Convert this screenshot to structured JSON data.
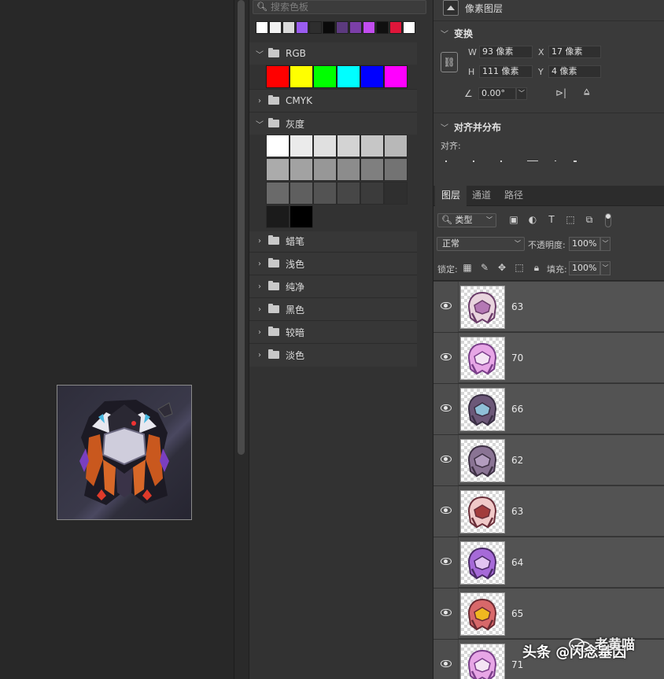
{
  "swatches": {
    "search_placeholder": "搜索色板",
    "recent_colors": [
      "#ffffff",
      "#f2f2f2",
      "#d9d9d9",
      "#9a5cf0",
      "#2e2e2e",
      "#0a0a0a",
      "#5c3a7e",
      "#7b3fa8",
      "#c24df0",
      "#101010",
      "#e0163a",
      "#ffffff"
    ],
    "groups": [
      {
        "label": "RGB",
        "expanded": true,
        "colors": [
          "#ff0000",
          "#ffff00",
          "#00ff00",
          "#00ffff",
          "#0000ff",
          "#ff00ff"
        ]
      },
      {
        "label": "CMYK",
        "expanded": false
      },
      {
        "label": "灰度",
        "expanded": true,
        "colors": [
          "#ffffff",
          "#ebebeb",
          "#e0e0e0",
          "#d3d3d3",
          "#c6c6c6",
          "#b8b8b8",
          "#ababab",
          "#a2a2a2",
          "#979797",
          "#8c8c8c",
          "#7f7f7f",
          "#737373",
          "#6a6a6a",
          "#5f5f5f",
          "#535353",
          "#474747",
          "#3b3b3b",
          "#2f2f2f",
          "#1b1b1b",
          "#000000"
        ]
      },
      {
        "label": "蜡笔",
        "expanded": false
      },
      {
        "label": "浅色",
        "expanded": false
      },
      {
        "label": "纯净",
        "expanded": false
      },
      {
        "label": "黑色",
        "expanded": false
      },
      {
        "label": "较暗",
        "expanded": false
      },
      {
        "label": "淡色",
        "expanded": false
      }
    ]
  },
  "properties": {
    "layer_type": "像素图层",
    "transform_title": "变换",
    "w_label": "W",
    "w_value": "93 像素",
    "x_label": "X",
    "x_value": "17 像素",
    "h_label": "H",
    "h_value": "111 像素",
    "y_label": "Y",
    "y_value": "4 像素",
    "angle_value": "0.00°",
    "align_title": "对齐并分布",
    "align_label": "对齐:"
  },
  "layers_panel": {
    "tabs": [
      "图层",
      "通道",
      "路径"
    ],
    "active_tab": "图层",
    "kind_filter": "类型",
    "blend_mode": "正常",
    "opacity_label": "不透明度:",
    "opacity_value": "100%",
    "lock_label": "锁定:",
    "fill_label": "填充:",
    "fill_value": "100%",
    "layers": [
      {
        "name": "63",
        "variant": "pale"
      },
      {
        "name": "70",
        "variant": "pink"
      },
      {
        "name": "66",
        "variant": "dark"
      },
      {
        "name": "62",
        "variant": "shell"
      },
      {
        "name": "63",
        "variant": "ring"
      },
      {
        "name": "64",
        "variant": "violet"
      },
      {
        "name": "65",
        "variant": "red"
      },
      {
        "name": "71",
        "variant": "pink"
      }
    ]
  },
  "watermark": {
    "text": "头条 @闪念基因",
    "overlay_text": "老黄喵"
  },
  "colors": {
    "panel_bg": "#323232",
    "props_bg": "#3a3a3a",
    "layer_row_bg": "#535353",
    "canvas_bg": "#282828"
  }
}
